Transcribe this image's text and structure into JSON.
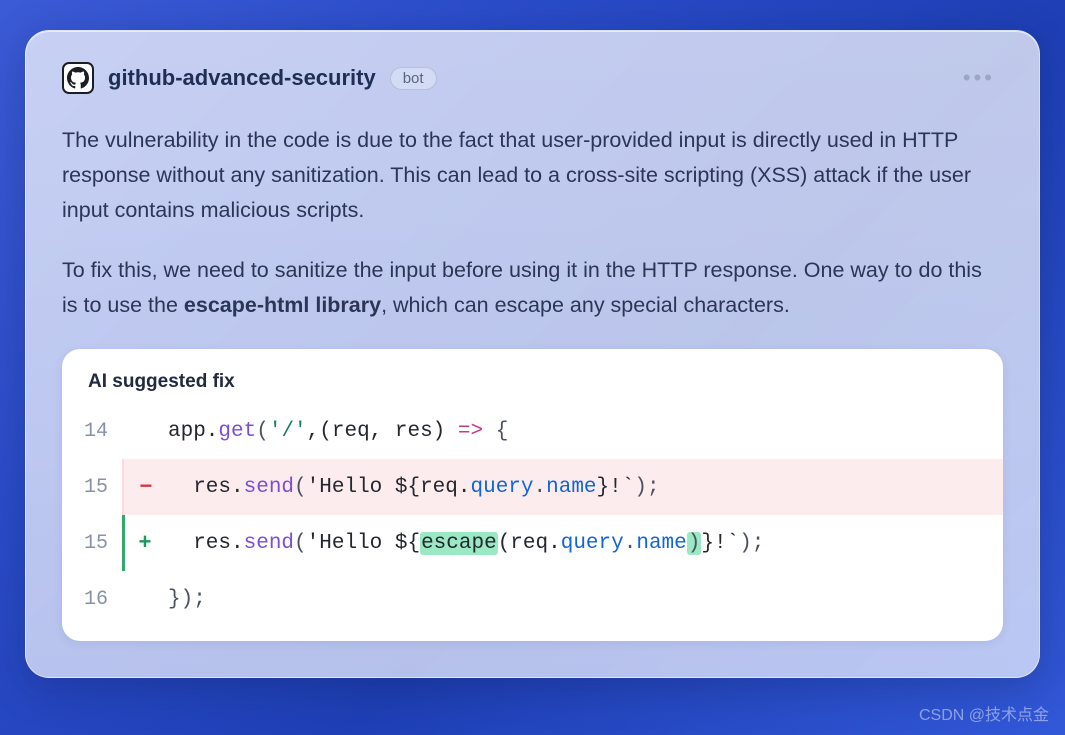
{
  "header": {
    "name": "github-advanced-security",
    "badge": "bot",
    "more_icon": "•••"
  },
  "description": {
    "p1": "The vulnerability in the code is due to the fact that user-provided input is directly used in HTTP response without any sanitization. This can lead to a cross-site scripting (XSS) attack if the user input contains malicious scripts.",
    "p2_a": "To fix this, we need to sanitize the input before using it in the HTTP response. One way to do this is to use the ",
    "p2_strong": "escape-html library",
    "p2_b": ", which can escape any special characters."
  },
  "code": {
    "title": "AI suggested fix",
    "lines": {
      "l14_num": "14",
      "l14": {
        "a": "app.",
        "b": "get",
        "c": "(",
        "d": "'/'",
        "e": ",(req, res) ",
        "f": "=>",
        "g": " {"
      },
      "l15m_num": "15",
      "l15m_sign": "−",
      "l15m": {
        "a": "  res.",
        "b": "send",
        "c": "(",
        "d": "'Hello ${req.",
        "e": "query",
        "f": ".",
        "g": "name",
        "h": "}!`",
        "i": ");"
      },
      "l15p_num": "15",
      "l15p_sign": "+",
      "l15p": {
        "a": "  res.",
        "b": "send",
        "c": "(",
        "d": "'Hello ${",
        "e": "escape",
        "f": "(req.",
        "g": "query",
        "h": ".",
        "i": "name",
        "j": ")",
        "k": "}!`",
        "l": ");"
      },
      "l16_num": "16",
      "l16": {
        "a": "});"
      }
    }
  },
  "watermark": "CSDN @技术点金"
}
